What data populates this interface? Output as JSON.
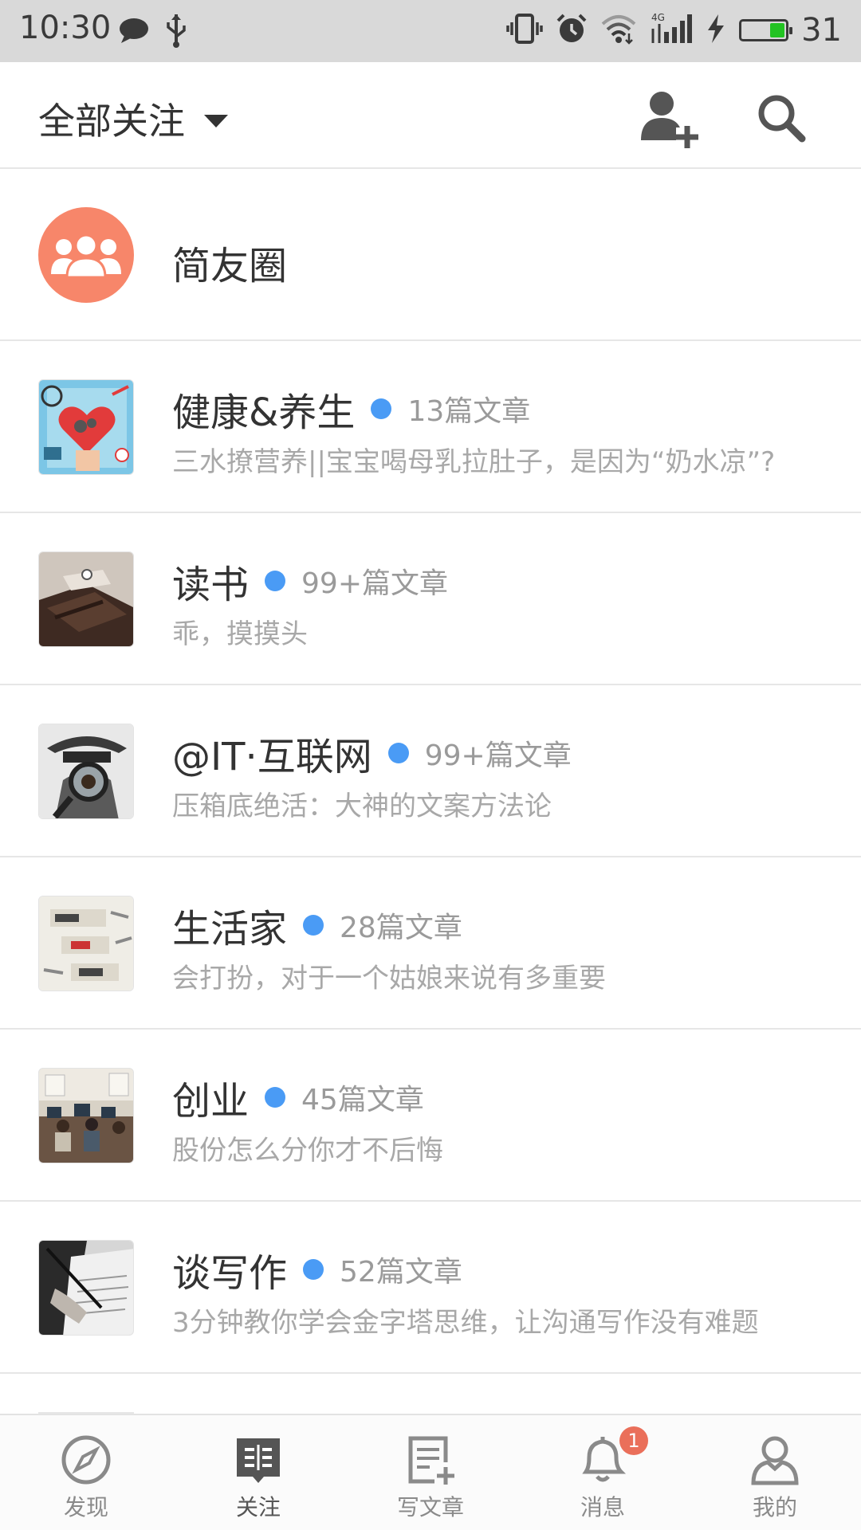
{
  "status_bar": {
    "time": "10:30",
    "battery_level": "31",
    "icons": [
      "chat-icon",
      "usb-icon",
      "vibrate-icon",
      "alarm-icon",
      "wifi-icon",
      "signal-4g-icon",
      "charging-icon",
      "battery-icon"
    ]
  },
  "header": {
    "title": "全部关注",
    "add_user_icon": "add-user-icon",
    "search_icon": "search-icon"
  },
  "friends_circle": {
    "label": "简友圈"
  },
  "items": [
    {
      "title": "健康&养生",
      "count": "13篇文章",
      "subtitle": "三水撩营养||宝宝喝母乳拉肚子，是因为“奶水凉”?"
    },
    {
      "title": "读书",
      "count": "99+篇文章",
      "subtitle": "乖，摸摸头"
    },
    {
      "title": "@IT·互联网",
      "count": "99+篇文章",
      "subtitle": "压箱底绝活：大神的文案方法论"
    },
    {
      "title": "生活家",
      "count": "28篇文章",
      "subtitle": "会打扮，对于一个姑娘来说有多重要"
    },
    {
      "title": "创业",
      "count": "45篇文章",
      "subtitle": "股份怎么分你才不后悔"
    },
    {
      "title": "谈写作",
      "count": "52篇文章",
      "subtitle": "3分钟教你学会金字塔思维，让沟通写作没有难题"
    }
  ],
  "bottom_nav": [
    {
      "label": "发现",
      "icon": "compass-icon"
    },
    {
      "label": "关注",
      "icon": "following-icon",
      "active": true
    },
    {
      "label": "写文章",
      "icon": "write-article-icon"
    },
    {
      "label": "消息",
      "icon": "bell-icon",
      "badge": "1"
    },
    {
      "label": "我的",
      "icon": "profile-icon"
    }
  ],
  "colors": {
    "accent_dot": "#4a9bf5",
    "friends_circle": "#f7866a",
    "badge": "#ea6f5a"
  }
}
